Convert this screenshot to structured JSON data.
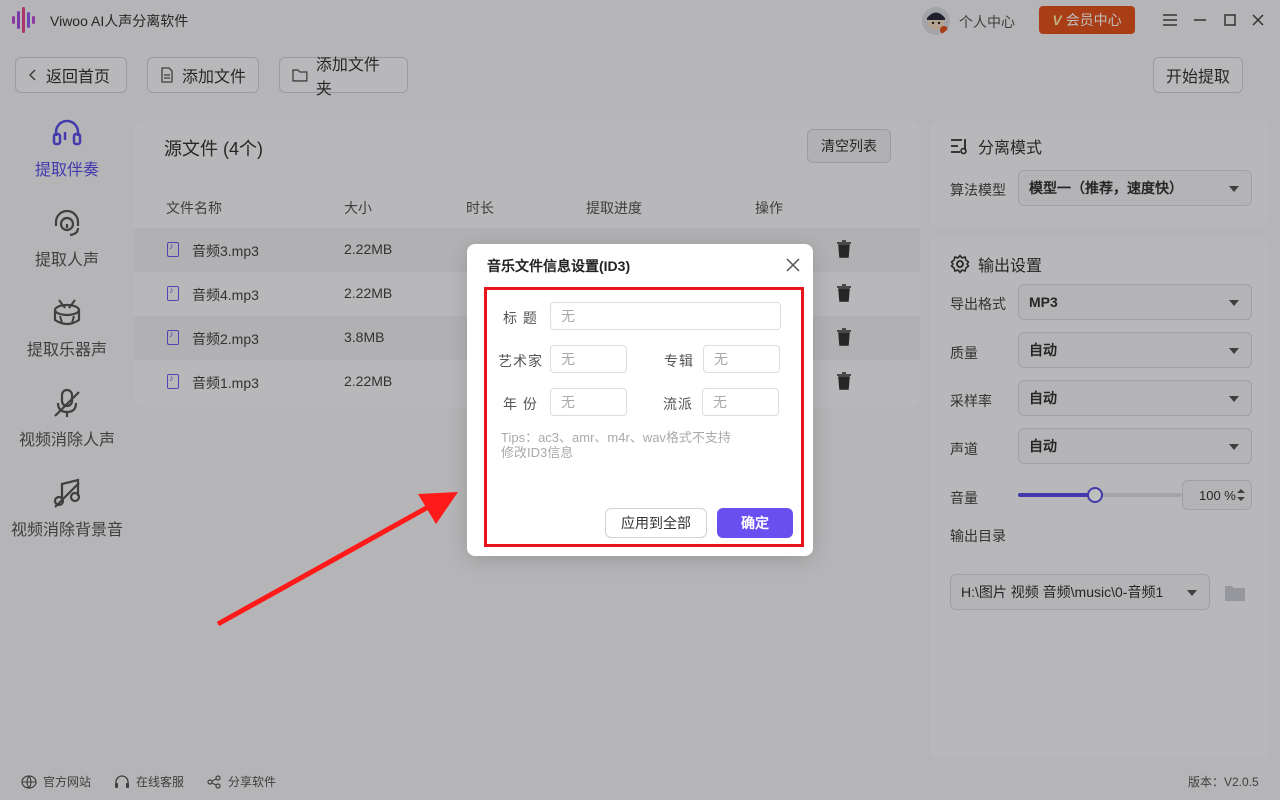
{
  "titlebar": {
    "app_title": "Viwoo AI人声分离软件",
    "personal_center": "个人中心",
    "vip_center": "会员中心",
    "vip_mark": "V"
  },
  "toolbar": {
    "back": "返回首页",
    "add_file": "添加文件",
    "add_folder": "添加文件夹",
    "start": "开始提取"
  },
  "nav": {
    "items": [
      {
        "label": "提取伴奏",
        "icon": "headphones-icon"
      },
      {
        "label": "提取人声",
        "icon": "headset-mic-icon"
      },
      {
        "label": "提取乐器声",
        "icon": "drum-icon"
      },
      {
        "label": "视频消除人声",
        "icon": "mic-off-icon"
      },
      {
        "label": "视频消除背景音",
        "icon": "music-off-icon"
      }
    ]
  },
  "source": {
    "title": "源文件 (4个)",
    "clear": "清空列表",
    "columns": [
      "文件名称",
      "大小",
      "时长",
      "提取进度",
      "操作"
    ],
    "rows": [
      {
        "name": "音频3.mp3",
        "size": "2.22MB"
      },
      {
        "name": "音频4.mp3",
        "size": "2.22MB"
      },
      {
        "name": "音频2.mp3",
        "size": "3.8MB"
      },
      {
        "name": "音频1.mp3",
        "size": "2.22MB"
      }
    ]
  },
  "separation": {
    "head": "分离模式",
    "model_label": "算法模型",
    "model_value": "模型一（推荐，速度快）"
  },
  "output": {
    "head": "输出设置",
    "format_label": "导出格式",
    "format_value": "MP3",
    "quality_label": "质量",
    "quality_value": "自动",
    "rate_label": "采样率",
    "rate_value": "自动",
    "channel_label": "声道",
    "channel_value": "自动",
    "volume_label": "音量",
    "volume_value": "100 %",
    "volume_fraction": 0.47,
    "dir_label": "输出目录",
    "dir_value": "H:\\图片 视频 音频\\music\\0-音频1"
  },
  "dialog": {
    "title": "音乐文件信息设置(ID3)",
    "title_label": "标 题",
    "title_placeholder": "无",
    "artist_label": "艺术家",
    "artist_placeholder": "无",
    "album_label": "专辑",
    "album_placeholder": "无",
    "year_label": "年 份",
    "year_placeholder": "无",
    "genre_label": "流派",
    "genre_placeholder": "无",
    "tips": "Tips：ac3、amr、m4r、wav格式不支持 修改ID3信息",
    "apply_all": "应用到全部",
    "confirm": "确定"
  },
  "footer": {
    "website": "官方网站",
    "service": "在线客服",
    "share": "分享软件",
    "version": "版本：V2.0.5"
  },
  "colors": {
    "accent": "#5b4ee8",
    "vip": "#e2521d",
    "highlight_box": "#e8141c"
  }
}
